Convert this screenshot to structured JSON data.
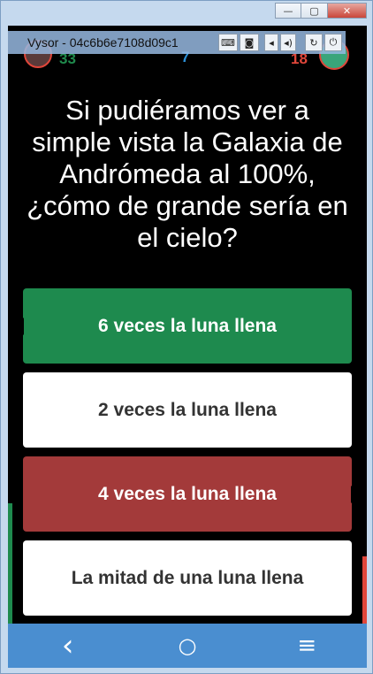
{
  "window": {
    "title": "Vysor - 04c6b6e7108d09c1",
    "controls": {
      "minimize": "—",
      "maximize": "▢",
      "close": "✕"
    }
  },
  "vysor": {
    "buttons": [
      "keyboard-icon",
      "camera-icon",
      "volume-down-icon",
      "volume-up-icon",
      "rotate-icon",
      "power-icon"
    ]
  },
  "game": {
    "player1_score": "33",
    "round": "7",
    "player2_score": "18",
    "question": "Si pudiéramos ver a simple vista la Galaxia de Andrómeda al 100%, ¿cómo de grande sería en el cielo?",
    "answers": [
      {
        "label": "6 veces la luna llena",
        "state": "correct",
        "color": "#1e8a4e"
      },
      {
        "label": "2 veces la luna llena",
        "state": "neutral",
        "color": "#ffffff"
      },
      {
        "label": "4 veces la luna llena",
        "state": "wrong",
        "color": "#a33a3a"
      },
      {
        "label": "La mitad de una luna llena",
        "state": "neutral",
        "color": "#ffffff"
      }
    ]
  },
  "navbar": {
    "back": "‹",
    "home": "○",
    "menu": "≡"
  }
}
